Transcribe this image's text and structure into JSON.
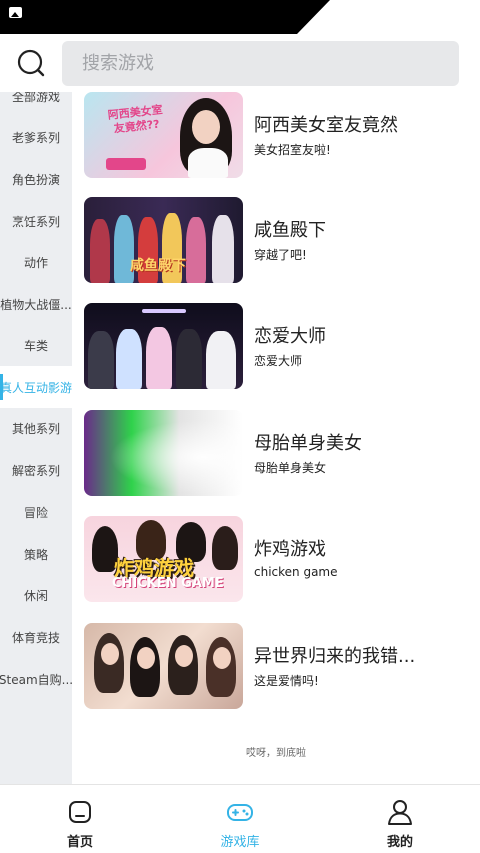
{
  "status_bar": {
    "icon": "image-notification-icon"
  },
  "search": {
    "placeholder": "搜索游戏",
    "value": ""
  },
  "sidebar": {
    "items": [
      {
        "label": "全部游戏",
        "active": false
      },
      {
        "label": "老爹系列",
        "active": false
      },
      {
        "label": "角色扮演",
        "active": false
      },
      {
        "label": "烹饪系列",
        "active": false
      },
      {
        "label": "动作",
        "active": false
      },
      {
        "label": "植物大战僵...",
        "active": false
      },
      {
        "label": "车类",
        "active": false
      },
      {
        "label": "真人互动影游",
        "active": true
      },
      {
        "label": "其他系列",
        "active": false
      },
      {
        "label": "解密系列",
        "active": false
      },
      {
        "label": "冒险",
        "active": false
      },
      {
        "label": "策略",
        "active": false
      },
      {
        "label": "休闲",
        "active": false
      },
      {
        "label": "体育竞技",
        "active": false
      },
      {
        "label": "Steam自购...",
        "active": false
      }
    ]
  },
  "games": [
    {
      "title": "阿西美女室友竟然",
      "subtitle": "美女招室友啦!",
      "thumb_text": "阿西美女室友竟然??"
    },
    {
      "title": "咸鱼殿下",
      "subtitle": "穿越了吧!",
      "thumb_text": "咸鱼殿下"
    },
    {
      "title": "恋爱大师",
      "subtitle": "恋爱大师",
      "thumb_text": ""
    },
    {
      "title": "母胎单身美女",
      "subtitle": "母胎单身美女",
      "thumb_text": ""
    },
    {
      "title": "炸鸡游戏",
      "subtitle": "chicken game",
      "thumb_text": "炸鸡游戏",
      "thumb_text_2": "CHICKEN GAME"
    },
    {
      "title": "异世界归来的我错...",
      "subtitle": "这是爱情吗!",
      "thumb_text": ""
    }
  ],
  "list_end_text": "哎呀，到底啦",
  "bottom_nav": {
    "items": [
      {
        "label": "首页",
        "icon": "home-icon",
        "active": false
      },
      {
        "label": "游戏库",
        "icon": "gamepad-icon",
        "active": true
      },
      {
        "label": "我的",
        "icon": "profile-icon",
        "active": false
      }
    ]
  },
  "colors": {
    "accent": "#34b3e6",
    "sidebar_bg": "#eceef1",
    "search_bg": "#e7e8ea"
  }
}
